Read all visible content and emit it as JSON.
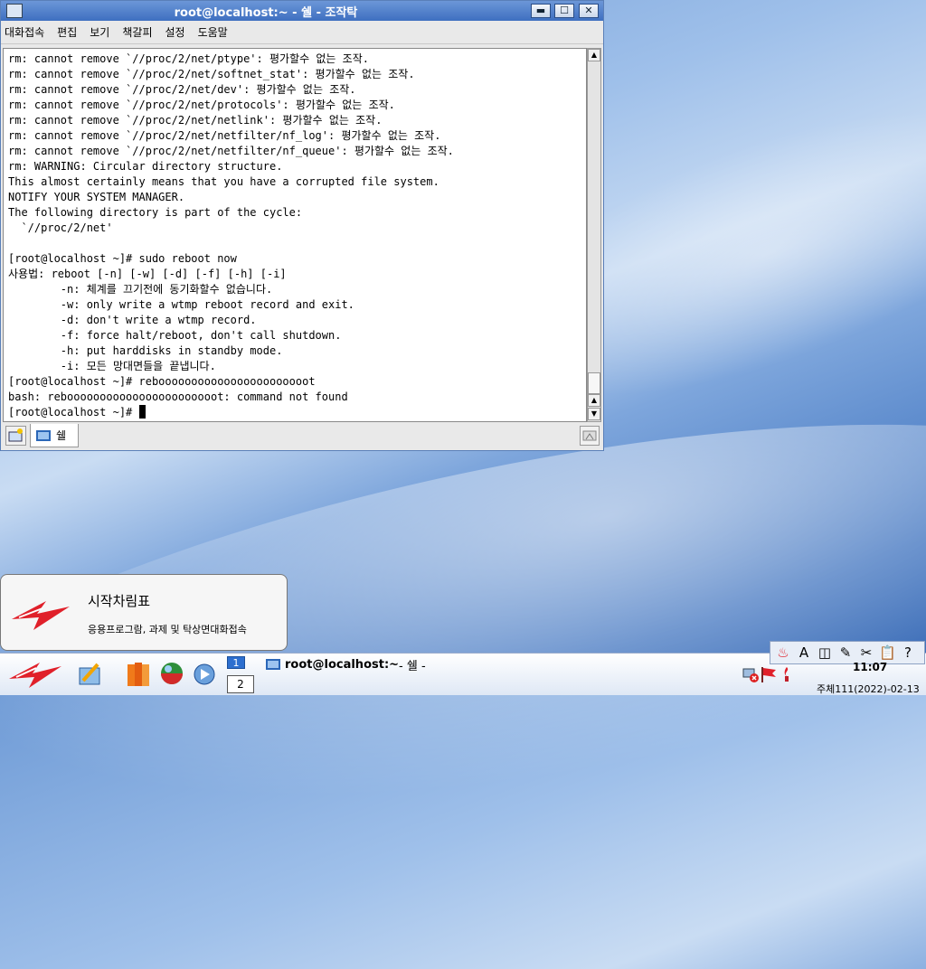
{
  "window": {
    "title": "root@localhost:~ - 쉘 - 조작탁",
    "controls": {
      "minimize": "▬",
      "maximize": "☐",
      "close": "✕"
    }
  },
  "menubar": [
    "대화접속",
    "편집",
    "보기",
    "책갈피",
    "설정",
    "도움말"
  ],
  "terminal": {
    "lines": [
      "rm: cannot remove `//proc/2/net/ptype': 평가할수 없는 조작.",
      "rm: cannot remove `//proc/2/net/softnet_stat': 평가할수 없는 조작.",
      "rm: cannot remove `//proc/2/net/dev': 평가할수 없는 조작.",
      "rm: cannot remove `//proc/2/net/protocols': 평가할수 없는 조작.",
      "rm: cannot remove `//proc/2/net/netlink': 평가할수 없는 조작.",
      "rm: cannot remove `//proc/2/net/netfilter/nf_log': 평가할수 없는 조작.",
      "rm: cannot remove `//proc/2/net/netfilter/nf_queue': 평가할수 없는 조작.",
      "rm: WARNING: Circular directory structure.",
      "This almost certainly means that you have a corrupted file system.",
      "NOTIFY YOUR SYSTEM MANAGER.",
      "The following directory is part of the cycle:",
      "  `//proc/2/net'",
      "",
      "[root@localhost ~]# sudo reboot now",
      "사용법: reboot [-n] [-w] [-d] [-f] [-h] [-i]",
      "        -n: 체계를 끄기전에 동기화할수 없습니다.",
      "        -w: only write a wtmp reboot record and exit.",
      "        -d: don't write a wtmp record.",
      "        -f: force halt/reboot, don't call shutdown.",
      "        -h: put harddisks in standby mode.",
      "        -i: 모든 망대면들을 끝냅니다.",
      "[root@localhost ~]# rebooooooooooooooooooooooot",
      "bash: rebooooooooooooooooooooooot: command not found"
    ],
    "prompt": "[root@localhost ~]# "
  },
  "tabs": [
    {
      "label": "쉘"
    }
  ],
  "start_popup": {
    "title": "시작차림표",
    "subtitle": "응용프로그람, 과제 및 탁상면대화접속"
  },
  "taskbar": {
    "workspaces": [
      "1",
      "2"
    ],
    "task": {
      "bold": "root@localhost:~",
      "rest": " - 쉘 - "
    },
    "time": "11:07",
    "date": "주체111(2022)-02-13",
    "tray_icons": [
      "flame-icon",
      "font-icon",
      "columns-icon",
      "notes-icon",
      "tools-icon",
      "clipboard-icon",
      "help-icon"
    ],
    "tray_glyphs": [
      "♨",
      "A",
      "◫",
      "✎",
      "✂",
      "📋",
      "?"
    ],
    "colors": {
      "accent": "#2d6fcf",
      "logo_red": "#e0202a"
    }
  }
}
